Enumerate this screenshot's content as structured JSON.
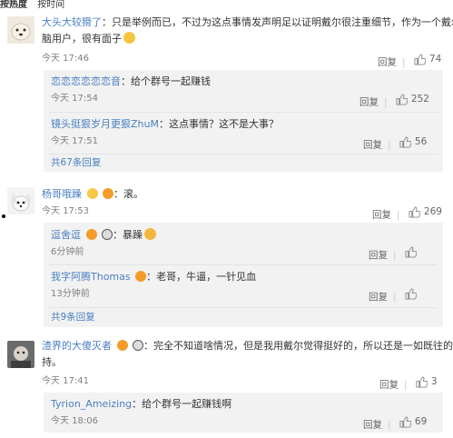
{
  "sort": {
    "hot": "按热度",
    "time": "按时间"
  },
  "comments": [
    {
      "user": "大头大较猾了",
      "text_line1": "：只是举例而已，不过为这点事情发声明足以证明戴尔很注重细节，作为一个戴尔电",
      "text_line2": "脑用户，很有面子",
      "time": "今天 17:46",
      "reply_label": "回复",
      "likes": "74",
      "replies": [
        {
          "user": "恋恋恋恋恋恋音",
          "text": "：给个群号一起赚钱",
          "time": "今天 17:54",
          "reply_label": "回复",
          "likes": "252"
        },
        {
          "user": "镜头挺狠岁月更狠ZhuM",
          "text": "：这点事情？这不是大事？",
          "time": "今天 17:51",
          "reply_label": "回复",
          "likes": "56"
        }
      ],
      "more": "共67条回复"
    },
    {
      "user": "杨哥哦躁",
      "text": "：滚。",
      "time": "今天 17:53",
      "reply_label": "回复",
      "likes": "269",
      "replies": [
        {
          "user": "逗舍逗",
          "text": "：暴躁",
          "time": "6分钟前",
          "reply_label": "回复",
          "likes": ""
        },
        {
          "user": "我字阿腾Thomas",
          "text": "：老哥，牛逼，一针见血",
          "time": "13分钟前",
          "reply_label": "回复",
          "likes": ""
        }
      ],
      "more": "共9条回复"
    },
    {
      "user": "渣界的大傻灭者",
      "text_line1": "：完全不知道啥情况，但是我用戴尔觉得挺好的，所以还是一如既往的支",
      "text_line2": "持。",
      "time": "今天 17:41",
      "reply_label": "回复",
      "likes": "3",
      "replies": [
        {
          "user": "Tyrion_Ameizing",
          "text": "：给个群号一起赚钱啊",
          "time": "今天 18:06",
          "reply_label": "回复",
          "likes": "69"
        }
      ]
    }
  ],
  "colors": {
    "link": "#4a7fc1",
    "reply_bg": "#f2f2f2",
    "muted": "#808080",
    "badge_orange": "#f39c2a"
  },
  "icons": {
    "like": "thumb-up-icon",
    "reply_emoji": "smile-emoji-icon",
    "panda": "panda-emoji-icon"
  }
}
